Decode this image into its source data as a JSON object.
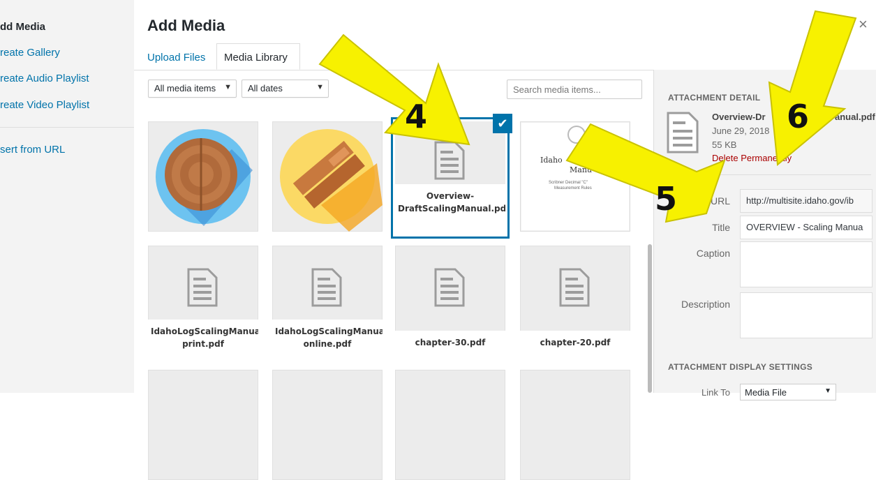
{
  "menu": {
    "items": [
      "dd Media",
      "reate Gallery",
      "reate Audio Playlist",
      "reate Video Playlist",
      "sert from URL"
    ]
  },
  "header": {
    "title": "Add Media",
    "close": "×"
  },
  "tabs": [
    "Upload Files",
    "Media Library"
  ],
  "filters": {
    "type": "All media items",
    "date": "All dates",
    "search_placeholder": "Search media items..."
  },
  "grid": {
    "selected_caption": "Overview-DraftScalingManual.pdf",
    "doc_preview": {
      "line1": "Idaho",
      "line2": "Manu",
      "line3": "Scribner Decimal \"C\"",
      "line4": "Measurement Rules"
    },
    "row2": [
      "IdahoLogScalingManual-print.pdf",
      "IdahoLogScalingManual-online.pdf",
      "chapter-30.pdf",
      "chapter-20.pdf"
    ]
  },
  "details": {
    "section_title": "ATTACHMENT DETAIL",
    "filename": "Overview-Dr",
    "filename_tail": "anual.pdf",
    "date": "June 29, 2018",
    "size": "55 KB",
    "delete": "Delete Permanently",
    "url_label": "URL",
    "url_value": "http://multisite.idaho.gov/ib",
    "title_label": "Title",
    "title_value": "OVERVIEW - Scaling Manua",
    "caption_label": "Caption",
    "description_label": "Description",
    "display_title": "ATTACHMENT DISPLAY SETTINGS",
    "link_label": "Link To",
    "link_value": "Media File"
  },
  "annotations": [
    "4",
    "5",
    "6"
  ],
  "colors": {
    "accent": "#0073aa",
    "arrow": "#f7f100",
    "delete": "#a00"
  }
}
